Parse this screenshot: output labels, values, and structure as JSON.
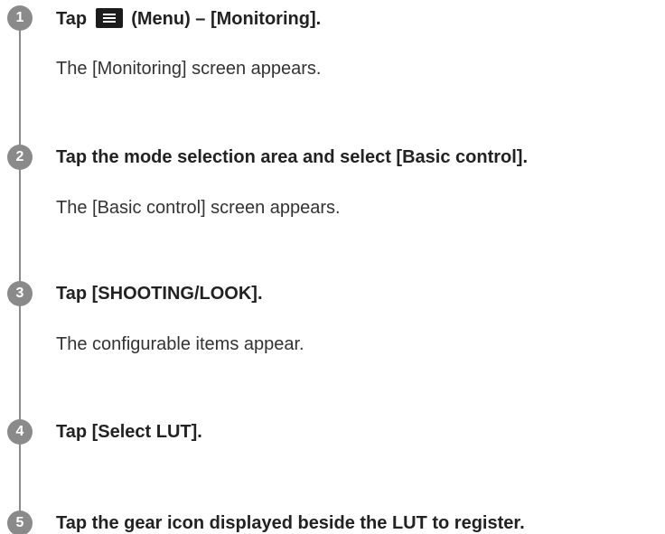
{
  "steps": [
    {
      "number": "1",
      "title_prefix": "Tap",
      "title_suffix": "(Menu) – [Monitoring].",
      "icon": "menu-icon",
      "description": "The [Monitoring] screen appears."
    },
    {
      "number": "2",
      "title": "Tap the mode selection area and select [Basic control].",
      "description": "The [Basic control] screen appears."
    },
    {
      "number": "3",
      "title": "Tap [SHOOTING/LOOK].",
      "description": "The configurable items appear."
    },
    {
      "number": "4",
      "title": "Tap [Select LUT]."
    },
    {
      "number": "5",
      "title": "Tap the gear icon displayed beside the LUT to register."
    }
  ],
  "colors": {
    "badge": "#8a8a8a",
    "timeline": "#8a8a8a",
    "icon_bg": "#1c1c1c"
  }
}
